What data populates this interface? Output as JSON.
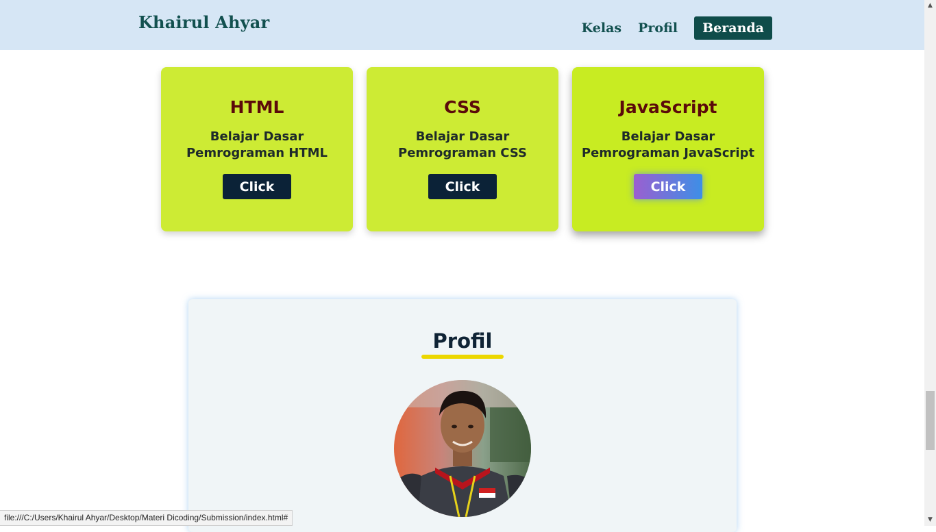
{
  "header": {
    "brand": "Khairul Ahyar",
    "nav": [
      {
        "label": "Kelas"
      },
      {
        "label": "Profil"
      },
      {
        "label": "Beranda",
        "active": true
      }
    ]
  },
  "cards": [
    {
      "title": "HTML",
      "description": "Belajar Dasar Pemrograman HTML",
      "button": "Click"
    },
    {
      "title": "CSS",
      "description": "Belajar Dasar Pemrograman CSS",
      "button": "Click"
    },
    {
      "title": "JavaScript",
      "description": "Belajar Dasar Pemrograman JavaScript",
      "button": "Click",
      "hovered": true
    }
  ],
  "profile": {
    "title": "Profil",
    "underline_color": "#ecd700"
  },
  "status_bar": {
    "url": "file:///C:/Users/Khairul Ahyar/Desktop/Materi Dicoding/Submission/index.html#"
  },
  "colors": {
    "header_bg": "#d6e6f5",
    "brand": "#12504f",
    "card_bg": "#cdeb34",
    "card_title": "#5b0a0a",
    "button_bg": "#0b2237"
  }
}
